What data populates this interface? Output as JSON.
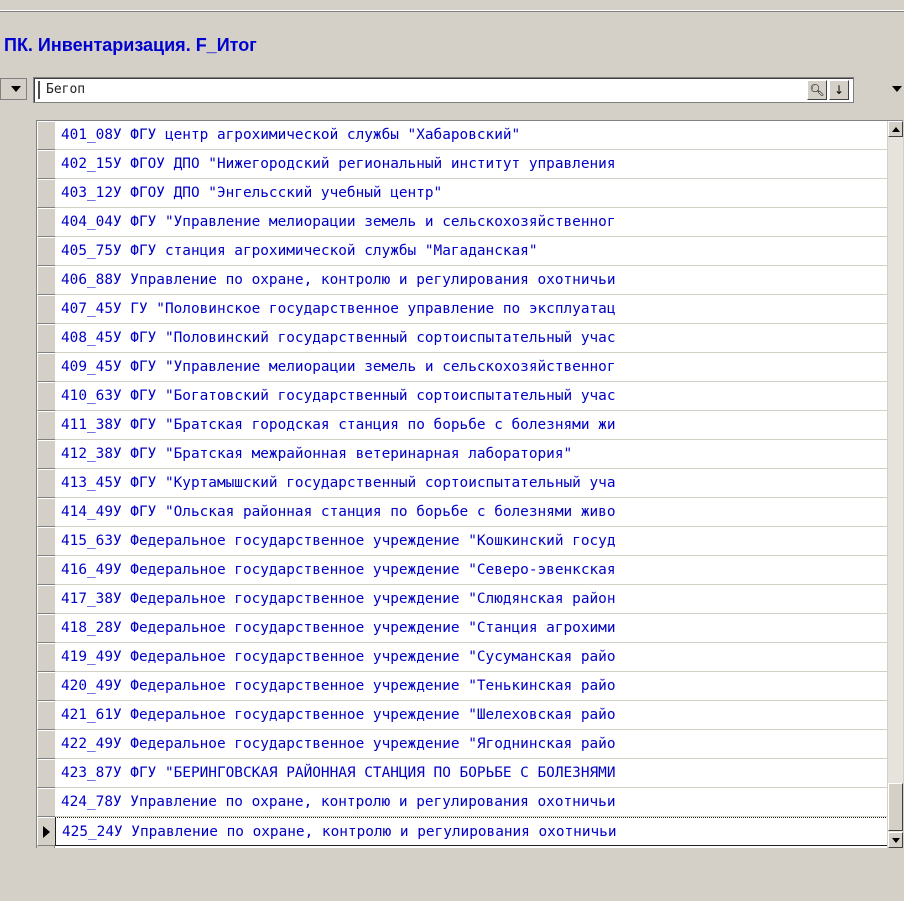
{
  "window": {
    "title": "ПК. Инвентаризация. F_Итог"
  },
  "search": {
    "value": "Бегоп"
  },
  "list": {
    "rows": [
      "401_08У ФГУ центр агрохимической службы \"Хабаровский\"",
      "402_15У ФГОУ ДПО \"Нижегородский региональный институт управления",
      "403_12У ФГОУ ДПО \"Энгельсский учебный центр\"",
      "404_04У ФГУ \"Управление мелиорации земель и сельскохозяйственног",
      "405_75У ФГУ станция агрохимической службы \"Магаданская\"",
      "406_88У Управление по охране, контролю и регулирования охотничьи",
      "407_45У ГУ \"Половинское государственное управление по эксплуатац",
      "408_45У ФГУ \"Половинский государственный сортоиспытательный учас",
      "409_45У ФГУ \"Управление мелиорации земель и сельскохозяйственног",
      "410_63У ФГУ \"Богатовский государственный сортоиспытательный учас",
      "411_38У ФГУ \"Братская городская станция по борьбе с болезнями жи",
      "412_38У ФГУ \"Братская межрайонная ветеринарная лаборатория\"",
      "413_45У ФГУ \"Куртамышский государственный сортоиспытательный уча",
      "414_49У ФГУ \"Ольская районная станция по борьбе с болезнями живо",
      "415_63У Федеральное государственное учреждение \"Кошкинский госуд",
      "416_49У Федеральное государственное учреждение \"Северо-эвенкская",
      "417_38У Федеральное государственное учреждение \"Слюдянская район",
      "418_28У Федеральное государственное учреждение \"Станция агрохими",
      "419_49У Федеральное государственное учреждение \"Сусуманская райо",
      "420_49У Федеральное государственное учреждение \"Тенькинская райо",
      "421_61У Федеральное государственное учреждение \"Шелеховская райо",
      "422_49У Федеральное государственное учреждение \"Ягоднинская райо",
      "423_87У ФГУ \"БЕРИНГОВСКАЯ РАЙОННАЯ СТАНЦИЯ ПО БОРЬБЕ С БОЛЕЗНЯМИ",
      "424_78У Управление по охране, контролю и регулирования охотничьи",
      "425_24У Управление по охране, контролю и регулирования охотничьи"
    ],
    "selected_index": 24
  },
  "colors": {
    "text": "#0000c8",
    "title": "#0000d0",
    "chrome": "#d4d0c8"
  }
}
